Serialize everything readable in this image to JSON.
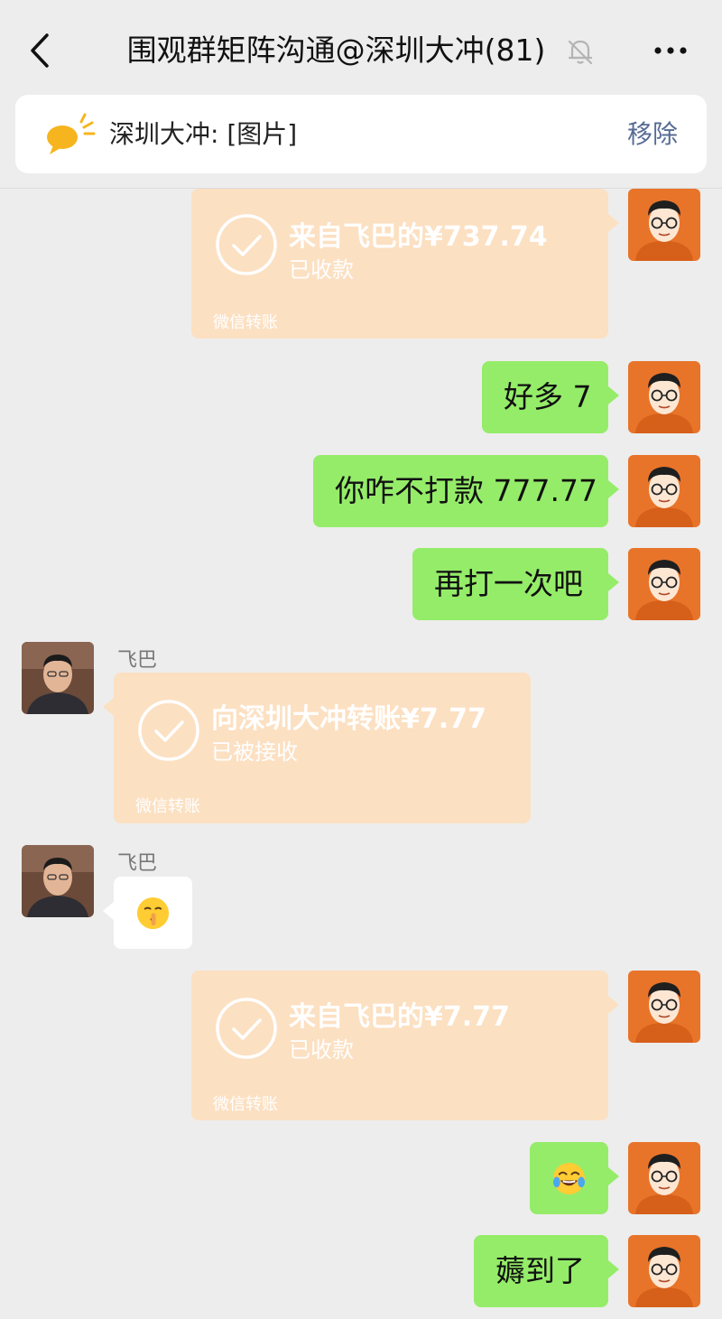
{
  "header": {
    "title": "围观群矩阵沟通@深圳大冲(81)",
    "back_icon": "chevron-left-icon",
    "mute_icon": "bell-muted-icon",
    "more_icon": "more-dots-icon"
  },
  "pinned": {
    "text": "深圳大冲: [图片]",
    "remove_label": "移除"
  },
  "messages": {
    "m1": {
      "title": "来自飞巴的¥737.74",
      "status": "已收款",
      "footer": "微信转账"
    },
    "m2": {
      "text": "好多 7"
    },
    "m3": {
      "text": "你咋不打款 777.77"
    },
    "m4": {
      "text": "再打一次吧"
    },
    "m5": {
      "sender": "飞巴",
      "title": "向深圳大冲转账¥7.77",
      "status": "已被接收",
      "footer": "微信转账"
    },
    "m6": {
      "sender": "飞巴",
      "emoji": "shushing-face"
    },
    "m7": {
      "title": "来自飞巴的¥7.77",
      "status": "已收款",
      "footer": "微信转账"
    },
    "m8": {
      "emoji": "tears-of-joy-face"
    },
    "m9": {
      "text": "薅到了"
    }
  },
  "colors": {
    "background": "#ededed",
    "bubble_me": "#95ec69",
    "bubble_other": "#ffffff",
    "transfer_received": "#fce0c2",
    "link": "#576b95"
  }
}
